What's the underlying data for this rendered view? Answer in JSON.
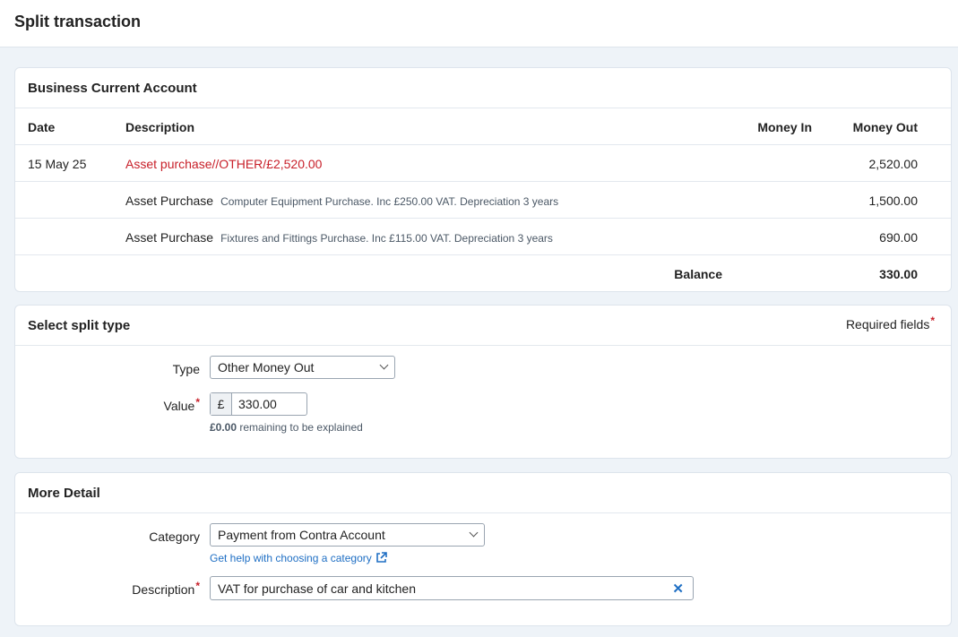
{
  "page": {
    "title": "Split transaction"
  },
  "account": {
    "title": "Business Current Account",
    "columns": {
      "date": "Date",
      "description": "Description",
      "money_in": "Money In",
      "money_out": "Money Out"
    },
    "transaction": {
      "date": "15 May 25",
      "description": "Asset purchase//OTHER/£2,520.00",
      "money_out": "2,520.00"
    },
    "splits": [
      {
        "label": "Asset Purchase",
        "note": "Computer Equipment Purchase. Inc £250.00 VAT. Depreciation 3 years",
        "money_out": "1,500.00"
      },
      {
        "label": "Asset Purchase",
        "note": "Fixtures and Fittings Purchase. Inc £115.00 VAT. Depreciation 3 years",
        "money_out": "690.00"
      }
    ],
    "balance": {
      "label": "Balance",
      "value": "330.00"
    }
  },
  "split_type": {
    "title": "Select split type",
    "required_label": "Required fields",
    "required_star": "*",
    "type_label": "Type",
    "type_value": "Other Money Out",
    "value_label": "Value",
    "currency_prefix": "£",
    "value": "330.00",
    "remaining_amount": "£0.00",
    "remaining_text": "remaining to be explained"
  },
  "more_detail": {
    "title": "More Detail",
    "category_label": "Category",
    "category_value": "Payment from Contra Account",
    "help_link": "Get help with choosing a category",
    "description_label": "Description",
    "description_value": "VAT for purchase of car and kitchen"
  },
  "icons": {
    "chevron": "chevron-down-icon",
    "external": "external-link-icon",
    "clear": "close-icon"
  },
  "colors": {
    "accent": "#1f6fc4",
    "error": "#c8202a"
  }
}
